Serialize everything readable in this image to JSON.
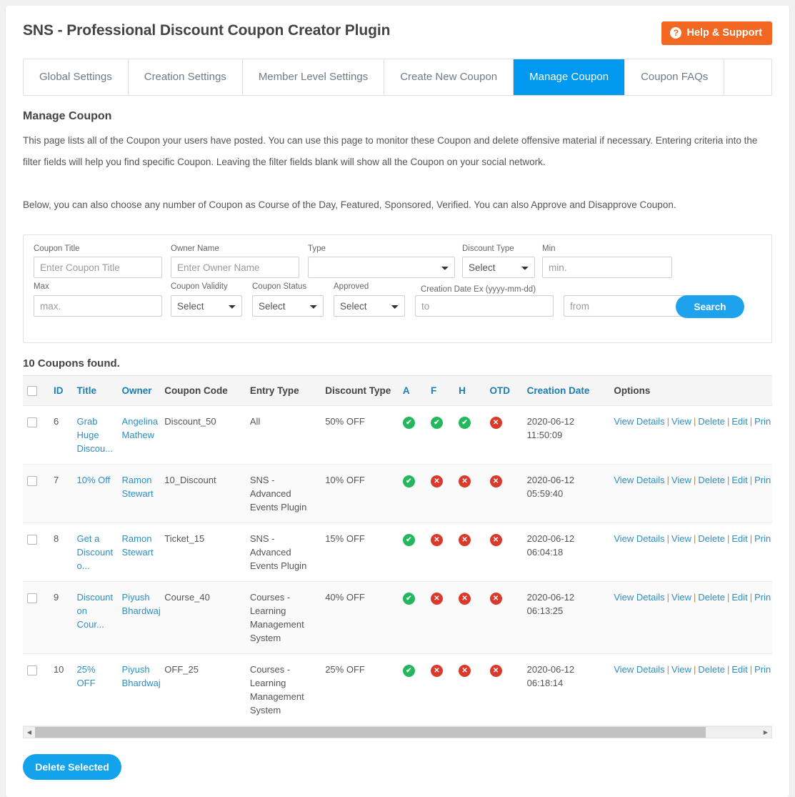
{
  "header": {
    "title": "SNS - Professional Discount Coupon Creator Plugin",
    "help_label": "Help & Support",
    "help_icon": "question-circle-icon",
    "accent": "#f26722"
  },
  "tabs": [
    {
      "label": "Global Settings",
      "active": false
    },
    {
      "label": "Creation Settings",
      "active": false
    },
    {
      "label": "Member Level Settings",
      "active": false
    },
    {
      "label": "Create New Coupon",
      "active": false
    },
    {
      "label": "Manage Coupon",
      "active": true
    },
    {
      "label": "Coupon FAQs",
      "active": false
    }
  ],
  "intro": {
    "title": "Manage Coupon",
    "paragraph1": "This page lists all of the Coupon your users have posted. You can use this page to monitor these Coupon and delete offensive material if necessary. Entering criteria into the filter fields will help you find specific Coupon. Leaving the filter fields blank will show all the Coupon on your social network.",
    "paragraph2": "Below, you can also choose any number of Coupon as Course of the Day, Featured, Sponsored, Verified. You can also Approve and Disapprove Coupon."
  },
  "filters": {
    "coupon_title": {
      "label": "Coupon Title",
      "placeholder": "Enter Coupon Title",
      "value": ""
    },
    "owner_name": {
      "label": "Owner Name",
      "placeholder": "Enter Owner Name",
      "value": ""
    },
    "type": {
      "label": "Type",
      "selected": "",
      "options": [
        ""
      ]
    },
    "discount_type": {
      "label": "Discount Type",
      "selected": "Select",
      "options": [
        "Select"
      ]
    },
    "min": {
      "label": "Min",
      "placeholder": "min.",
      "value": ""
    },
    "max": {
      "label": "Max",
      "placeholder": "max.",
      "value": ""
    },
    "coupon_validity": {
      "label": "Coupon Validity",
      "selected": "Select",
      "options": [
        "Select"
      ]
    },
    "coupon_status": {
      "label": "Coupon Status",
      "selected": "Select",
      "options": [
        "Select"
      ]
    },
    "approved": {
      "label": "Approved",
      "selected": "Select",
      "options": [
        "Select"
      ]
    },
    "date_hint": "Creation Date Ex (yyyy-mm-dd)",
    "date_to": {
      "placeholder": "to",
      "value": ""
    },
    "date_from": {
      "placeholder": "from",
      "value": ""
    },
    "search_label": "Search"
  },
  "results": {
    "found_text": "10 Coupons found.",
    "columns": [
      {
        "key": "checkbox",
        "label": "",
        "link": false
      },
      {
        "key": "id",
        "label": "ID",
        "link": true
      },
      {
        "key": "title",
        "label": "Title",
        "link": true
      },
      {
        "key": "owner",
        "label": "Owner",
        "link": true
      },
      {
        "key": "coupon_code",
        "label": "Coupon Code",
        "link": false
      },
      {
        "key": "entry_type",
        "label": "Entry Type",
        "link": false
      },
      {
        "key": "discount_type",
        "label": "Discount Type",
        "link": false
      },
      {
        "key": "a",
        "label": "A",
        "link": true
      },
      {
        "key": "f",
        "label": "F",
        "link": true
      },
      {
        "key": "h",
        "label": "H",
        "link": true
      },
      {
        "key": "otd",
        "label": "OTD",
        "link": true
      },
      {
        "key": "creation_date",
        "label": "Creation Date",
        "link": true
      },
      {
        "key": "options",
        "label": "Options",
        "link": false
      }
    ],
    "option_links": [
      "View Details",
      "View",
      "Delete",
      "Edit",
      "Prin"
    ],
    "rows": [
      {
        "id": "6",
        "title": "Grab Huge Discou...",
        "owner": "Angelina Mathew",
        "coupon_code": "Discount_50",
        "entry_type": "All",
        "discount_type": "50% OFF",
        "a": true,
        "f": true,
        "h": true,
        "otd": false,
        "creation_date": "2020-06-12 11:50:09"
      },
      {
        "id": "7",
        "title": "10% Off",
        "owner": "Ramon Stewart",
        "coupon_code": "10_Discount",
        "entry_type": "SNS - Advanced Events Plugin",
        "discount_type": "10% OFF",
        "a": true,
        "f": false,
        "h": false,
        "otd": false,
        "creation_date": "2020-06-12 05:59:40"
      },
      {
        "id": "8",
        "title": "Get a Discount o...",
        "owner": "Ramon Stewart",
        "coupon_code": "Ticket_15",
        "entry_type": "SNS - Advanced Events Plugin",
        "discount_type": "15% OFF",
        "a": true,
        "f": false,
        "h": false,
        "otd": false,
        "creation_date": "2020-06-12 06:04:18"
      },
      {
        "id": "9",
        "title": "Discount on Cour...",
        "owner": "Piyush Bhardwaj",
        "coupon_code": "Course_40",
        "entry_type": "Courses - Learning Management System",
        "discount_type": "40% OFF",
        "a": true,
        "f": false,
        "h": false,
        "otd": false,
        "creation_date": "2020-06-12 06:13:25"
      },
      {
        "id": "10",
        "title": "25% OFF",
        "owner": "Piyush Bhardwaj",
        "coupon_code": "OFF_25",
        "entry_type": "Courses - Learning Management System",
        "discount_type": "25% OFF",
        "a": true,
        "f": false,
        "h": false,
        "otd": false,
        "creation_date": "2020-06-12 06:18:14"
      }
    ]
  },
  "footer": {
    "delete_label": "Delete Selected"
  },
  "colors": {
    "tab_active": "#0099ef",
    "link": "#2e8fc4",
    "yes": "#23b85e",
    "no": "#d93a2b",
    "button_blue": "#13a3ec"
  }
}
